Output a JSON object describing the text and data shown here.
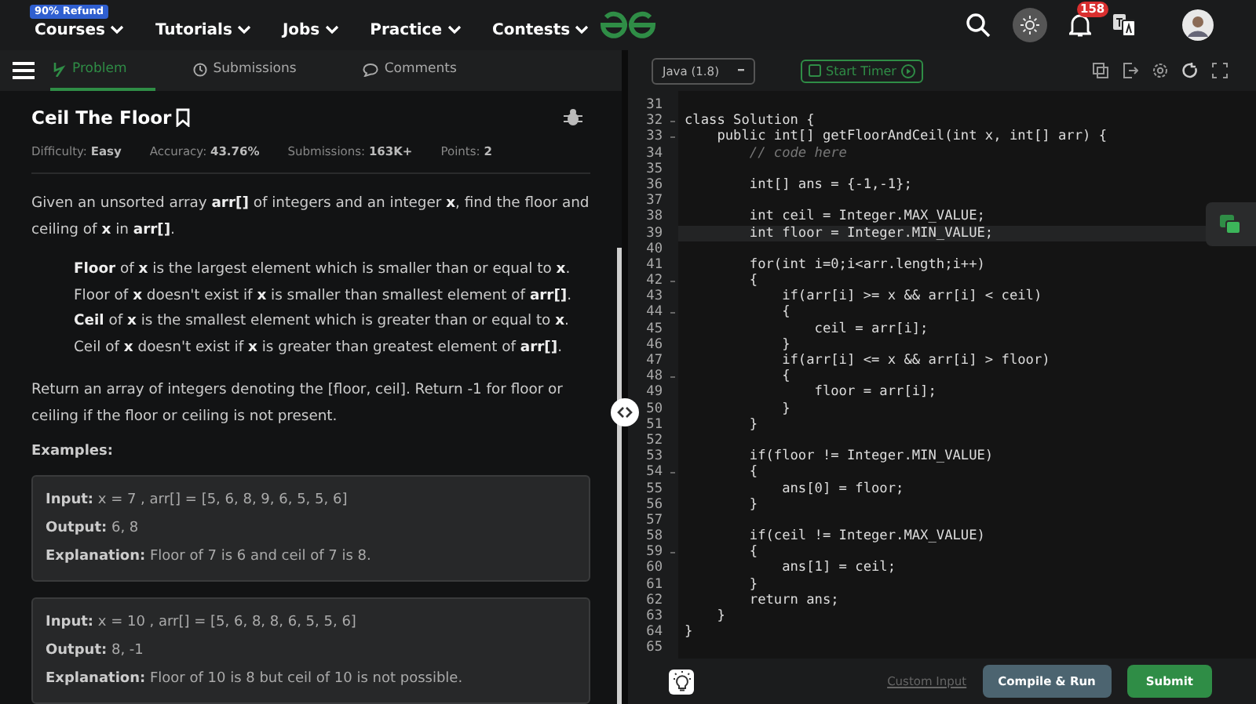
{
  "nav": {
    "badge": "90% Refund",
    "items": [
      {
        "label": "Courses"
      },
      {
        "label": "Tutorials"
      },
      {
        "label": "Jobs"
      },
      {
        "label": "Practice"
      },
      {
        "label": "Contests"
      }
    ],
    "notifications": "158"
  },
  "tabs": [
    {
      "label": "Problem",
      "selected": true
    },
    {
      "label": "Submissions",
      "selected": false
    },
    {
      "label": "Comments",
      "selected": false
    }
  ],
  "problem": {
    "title": "Ceil The Floor",
    "meta": [
      {
        "label": "Difficulty:",
        "value": "Easy"
      },
      {
        "label": "Accuracy:",
        "value": "43.76%"
      },
      {
        "label": "Submissions:",
        "value": "163K+"
      },
      {
        "label": "Points:",
        "value": "2"
      }
    ],
    "intro": "Given an unsorted array **arr[]** of integers and an integer **x**, find the floor and ceiling of **x** in **arr[]**.",
    "notes": [
      "**Floor** of **x** is the largest element which is smaller than or equal to **x**.",
      "Floor of **x** doesn't exist if **x** is smaller than smallest element of **arr[]**.",
      "**Ceil** of **x** is the smallest element which is greater than or equal to **x**.",
      "Ceil of **x** doesn't exist if **x** is greater than greatest element of **arr[]**."
    ],
    "returns": "Return an array of integers denoting the [floor, ceil]. Return -1 for floor or ceiling if the floor or ceiling is not present.",
    "examples_heading": "Examples:",
    "examples": [
      [
        {
          "label": "Input:",
          "value": "x = 7 , arr[] = [5, 6, 8, 9, 6, 5, 5, 6]"
        },
        {
          "label": "Output:",
          "value": "6, 8"
        },
        {
          "label": "Explanation:",
          "value": "Floor of 7 is 6 and ceil of 7 is 8."
        }
      ],
      [
        {
          "label": "Input:",
          "value": "x = 10 , arr[] = [5, 6, 8, 8, 6, 5, 5, 6]"
        },
        {
          "label": "Output:",
          "value": "8, -1"
        },
        {
          "label": "Explanation:",
          "value": "Floor of 10 is 8 but ceil of 10 is not possible."
        }
      ]
    ]
  },
  "editor": {
    "language": "Java (1.8)",
    "timer": "Start Timer",
    "lines": [
      {
        "n": "31",
        "fold": false,
        "active": false
      },
      {
        "n": "32",
        "code": "class Solution {",
        "fold": true,
        "active": false
      },
      {
        "n": "33",
        "code": "    public int[] getFloorAndCeil(int x, int[] arr) {",
        "fold": true,
        "active": false
      },
      {
        "n": "34",
        "code": "        // code here",
        "fold": false,
        "active": false,
        "kind": "comment"
      },
      {
        "n": "35",
        "fold": false,
        "active": false
      },
      {
        "n": "36",
        "code": "        int[] ans = {-1,-1};",
        "fold": false,
        "active": false
      },
      {
        "n": "37",
        "fold": false,
        "active": false
      },
      {
        "n": "38",
        "code": "        int ceil = Integer.MAX_VALUE;",
        "fold": false,
        "active": false
      },
      {
        "n": "39",
        "code": "        int floor = Integer.MIN_VALUE;",
        "fold": false,
        "active": true
      },
      {
        "n": "40",
        "fold": false,
        "active": false
      },
      {
        "n": "41",
        "code": "        for(int i=0;i<arr.length;i++)",
        "fold": false,
        "active": false
      },
      {
        "n": "42",
        "code": "        {",
        "fold": true,
        "active": false
      },
      {
        "n": "43",
        "code": "            if(arr[i] >= x && arr[i] < ceil)",
        "fold": false,
        "active": false
      },
      {
        "n": "44",
        "code": "            {",
        "fold": true,
        "active": false
      },
      {
        "n": "45",
        "code": "                ceil = arr[i];",
        "fold": false,
        "active": false
      },
      {
        "n": "46",
        "code": "            }",
        "fold": false,
        "active": false
      },
      {
        "n": "47",
        "code": "            if(arr[i] <= x && arr[i] > floor)",
        "fold": false,
        "active": false
      },
      {
        "n": "48",
        "code": "            {",
        "fold": true,
        "active": false
      },
      {
        "n": "49",
        "code": "                floor = arr[i];",
        "fold": false,
        "active": false
      },
      {
        "n": "50",
        "code": "            }",
        "fold": false,
        "active": false
      },
      {
        "n": "51",
        "code": "        }",
        "fold": false,
        "active": false
      },
      {
        "n": "52",
        "fold": false,
        "active": false
      },
      {
        "n": "53",
        "code": "        if(floor != Integer.MIN_VALUE)",
        "fold": false,
        "active": false
      },
      {
        "n": "54",
        "code": "        {",
        "fold": true,
        "active": false
      },
      {
        "n": "55",
        "code": "            ans[0] = floor;",
        "fold": false,
        "active": false
      },
      {
        "n": "56",
        "code": "        }",
        "fold": false,
        "active": false
      },
      {
        "n": "57",
        "fold": false,
        "active": false
      },
      {
        "n": "58",
        "code": "        if(ceil != Integer.MAX_VALUE)",
        "fold": false,
        "active": false
      },
      {
        "n": "59",
        "code": "        {",
        "fold": true,
        "active": false
      },
      {
        "n": "60",
        "code": "            ans[1] = ceil;",
        "fold": false,
        "active": false
      },
      {
        "n": "61",
        "code": "        }",
        "fold": false,
        "active": false
      },
      {
        "n": "62",
        "code": "        return ans;",
        "fold": false,
        "active": false
      },
      {
        "n": "63",
        "code": "    }",
        "fold": false,
        "active": false
      },
      {
        "n": "64",
        "code": "}",
        "fold": false,
        "active": false
      },
      {
        "n": "65",
        "fold": false,
        "active": false
      }
    ],
    "custom_input": "Custom Input",
    "compile": "Compile & Run",
    "submit": "Submit"
  }
}
